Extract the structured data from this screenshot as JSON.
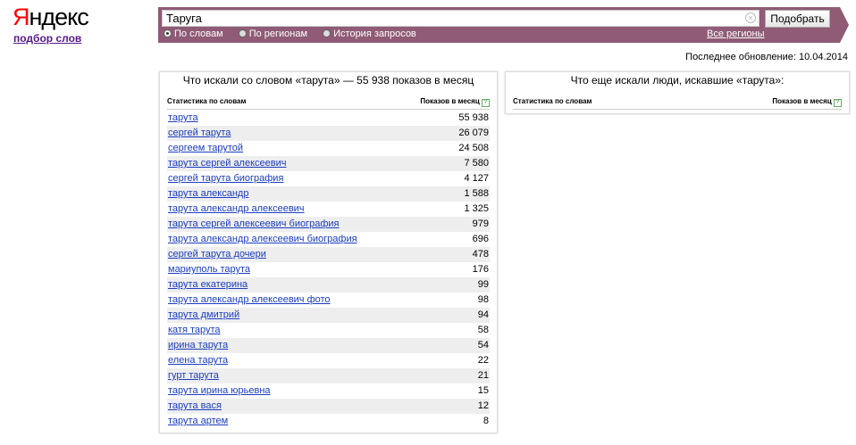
{
  "logo": {
    "first": "Я",
    "rest": "ндекс"
  },
  "sublink": "подбор слов",
  "search": {
    "value": "Таруга",
    "button": "Подобрать"
  },
  "modes": [
    "По словам",
    "По регионам",
    "История запросов"
  ],
  "regions_link": "Все регионы",
  "updated": "Последнее обновление: 10.04.2014",
  "left_panel": {
    "title": "Что искали со словом «тарута» — 55 938 показов в месяц",
    "col1": "Статистика по словам",
    "col2": "Показов в месяц",
    "rows": [
      {
        "q": "тарута",
        "n": "55 938"
      },
      {
        "q": "сергей тарута",
        "n": "26 079"
      },
      {
        "q": "сергеем тарутой",
        "n": "24 508"
      },
      {
        "q": "тарута сергей алексеевич",
        "n": "7 580"
      },
      {
        "q": "сергей тарута биография",
        "n": "4 127"
      },
      {
        "q": "тарута александр",
        "n": "1 588"
      },
      {
        "q": "тарута александр алексеевич",
        "n": "1 325"
      },
      {
        "q": "тарута сергей алексеевич биография",
        "n": "979"
      },
      {
        "q": "тарута александр алексеевич биография",
        "n": "696"
      },
      {
        "q": "сергей тарута дочери",
        "n": "478"
      },
      {
        "q": "мариуполь тарута",
        "n": "176"
      },
      {
        "q": "тарута екатерина",
        "n": "99"
      },
      {
        "q": "тарута александр алексеевич фото",
        "n": "98"
      },
      {
        "q": "тарута дмитрий",
        "n": "94"
      },
      {
        "q": "катя тарута",
        "n": "58"
      },
      {
        "q": "ирина тарута",
        "n": "54"
      },
      {
        "q": "елена тарута",
        "n": "22"
      },
      {
        "q": "гурт тарута",
        "n": "21"
      },
      {
        "q": "тарута ирина юрьевна",
        "n": "15"
      },
      {
        "q": "тарута вася",
        "n": "12"
      },
      {
        "q": "тарута артем",
        "n": "8"
      }
    ]
  },
  "right_panel": {
    "title": "Что еще искали люди, искавшие «тарута»:",
    "col1": "Статистика по словам",
    "col2": "Показов в месяц"
  },
  "colors": {
    "bar": "#8f5b75",
    "link": "#1a3dc1"
  }
}
